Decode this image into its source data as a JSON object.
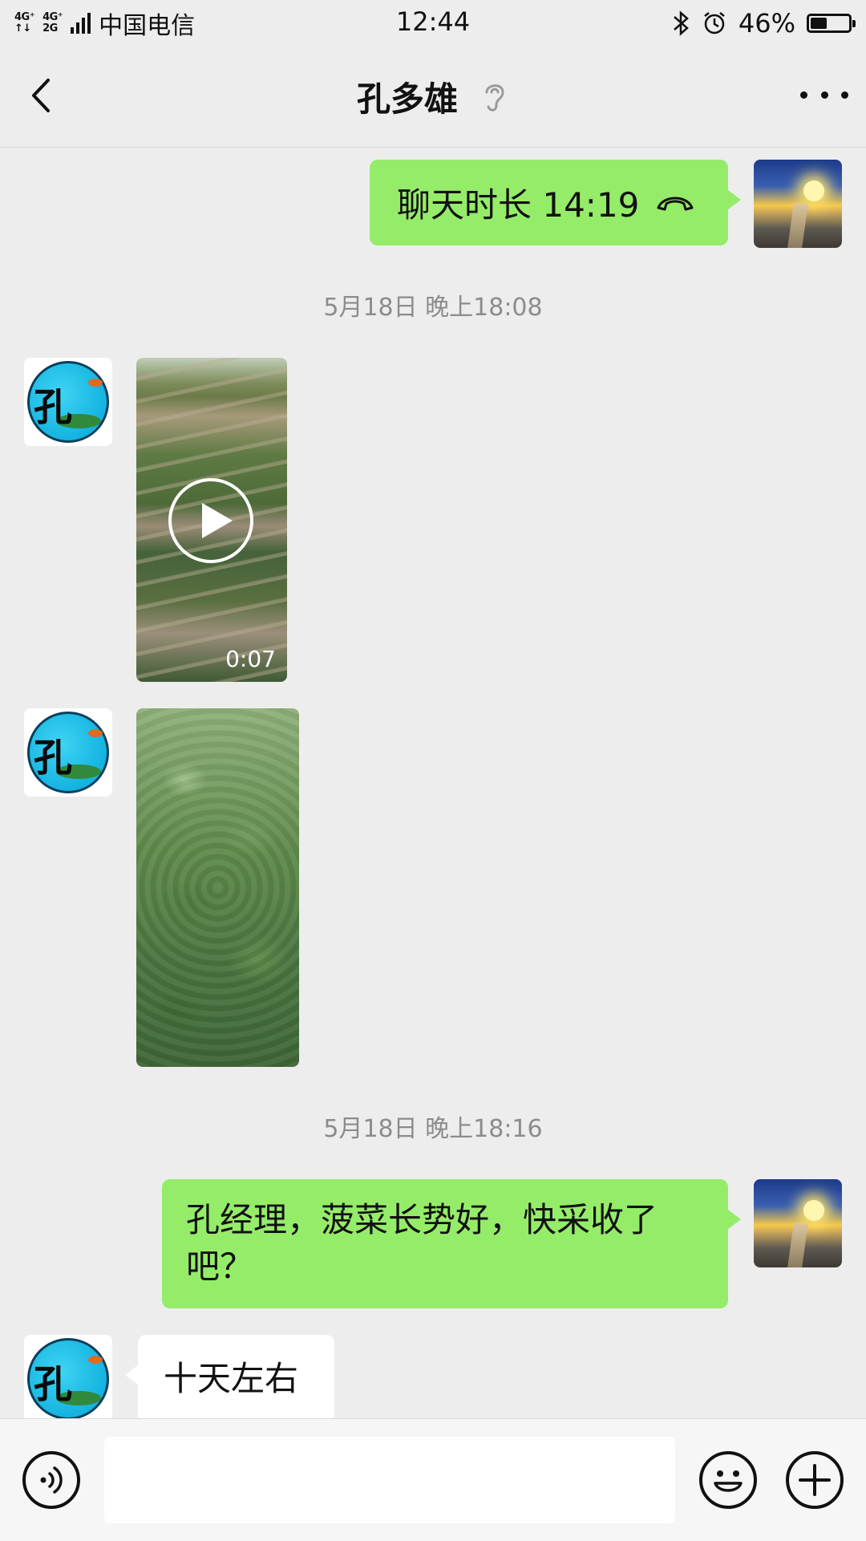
{
  "status_bar": {
    "network_1": [
      "4G⁺",
      "↑↓"
    ],
    "network_2": [
      "4G⁺",
      "2G"
    ],
    "carrier": "中国电信",
    "time": "12:44",
    "battery_text": "46%",
    "battery_level": 0.46,
    "icons": [
      "bluetooth-icon",
      "alarm-icon",
      "battery-icon"
    ]
  },
  "header": {
    "title": "孔多雄",
    "icons": [
      "back-arrow-icon",
      "earpiece-icon",
      "more-icon"
    ]
  },
  "messages": [
    {
      "side": "right",
      "type": "call",
      "text": "聊天时长 14:19",
      "icon": "phone-hangup-icon"
    },
    {
      "type": "timestamp",
      "text": "5月18日 晚上18:08"
    },
    {
      "side": "left",
      "type": "video",
      "duration": "0:07"
    },
    {
      "side": "left",
      "type": "image"
    },
    {
      "type": "timestamp",
      "text": "5月18日 晚上18:16"
    },
    {
      "side": "right",
      "type": "text",
      "lines": [
        "孔经理，菠菜长势好，快采收了",
        "吧？"
      ]
    },
    {
      "side": "left",
      "type": "text",
      "text": "十天左右"
    }
  ],
  "avatar_other_char": "孔",
  "input_bar": {
    "value": "",
    "icons": [
      "voice-icon",
      "emoji-icon",
      "plus-icon"
    ]
  },
  "colors": {
    "background": "#ededed",
    "bubble_mine": "#95ec69",
    "bubble_other": "#ffffff",
    "timestamp_text": "#8c8c8c"
  }
}
